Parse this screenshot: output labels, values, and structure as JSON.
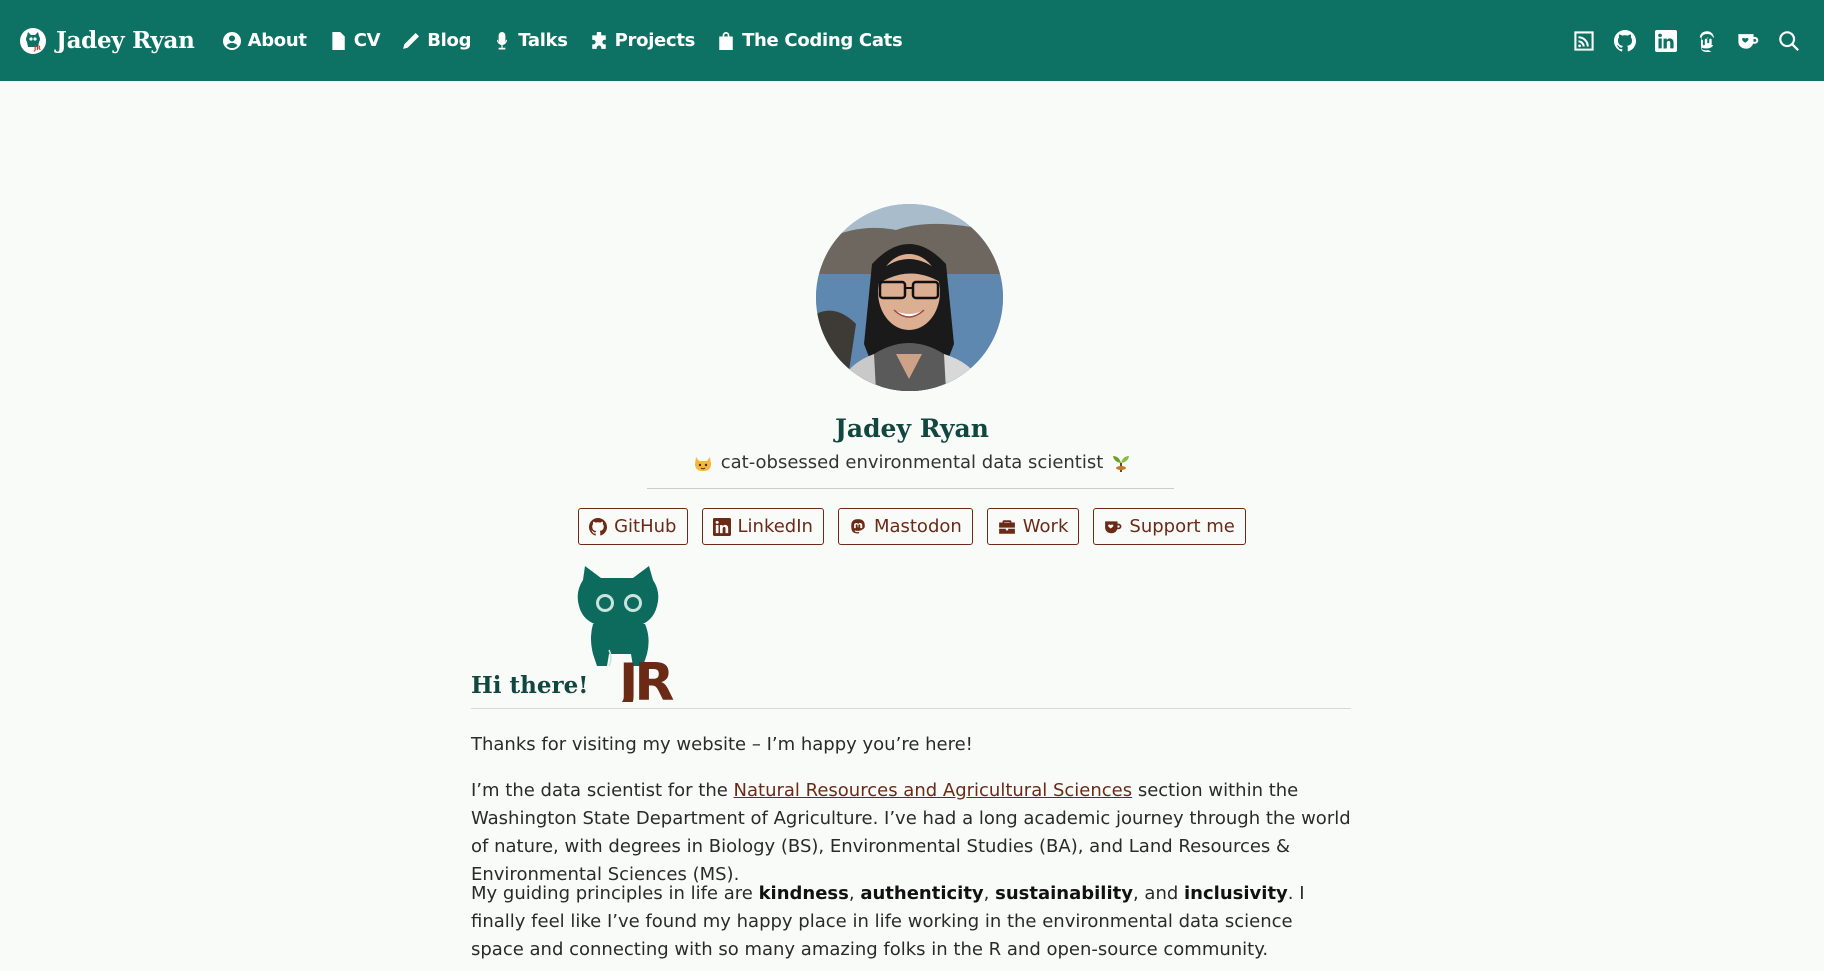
{
  "nav": {
    "brand": "Jadey Ryan",
    "links": [
      {
        "label": "About",
        "icon": "person-circle-icon"
      },
      {
        "label": "CV",
        "icon": "file-text-icon"
      },
      {
        "label": "Blog",
        "icon": "pencil-icon"
      },
      {
        "label": "Talks",
        "icon": "microphone-icon"
      },
      {
        "label": "Projects",
        "icon": "puzzle-icon"
      },
      {
        "label": "The Coding Cats",
        "icon": "bag-icon"
      }
    ],
    "right_icons": [
      "rss-icon",
      "github-icon",
      "linkedin-icon",
      "mastodon-icon",
      "kofi-cup-icon",
      "search-icon"
    ]
  },
  "profile": {
    "name": "Jadey Ryan",
    "tagline": "cat-obsessed environmental data scientist"
  },
  "buttons": [
    {
      "label": "GitHub",
      "icon": "github-icon"
    },
    {
      "label": "LinkedIn",
      "icon": "linkedin-icon"
    },
    {
      "label": "Mastodon",
      "icon": "mastodon-icon"
    },
    {
      "label": "Work",
      "icon": "briefcase-icon"
    },
    {
      "label": "Support me",
      "icon": "kofi-cup-icon"
    }
  ],
  "content": {
    "heading": "Hi there!",
    "p1": "Thanks for visiting my website – I’m happy you’re here!",
    "p2_before": "I’m the data scientist for the ",
    "p2_link": "Natural Resources and Agricultural Sciences",
    "p2_after": " section within the Washington State Department of Agriculture. I’ve had a long academic journey through the world of nature, with degrees in Biology (BS), Environmental Studies (BA), and Land Resources & Environmental Sciences (MS).",
    "p3_a": "My guiding principles in life are ",
    "p3_kindness": "kindness",
    "p3_sep1": ", ",
    "p3_authenticity": "authenticity",
    "p3_sep2": ", ",
    "p3_sustainability": "sustainability",
    "p3_sep3": ", and ",
    "p3_inclusivity": "inclusivity",
    "p3_b": ". I finally feel like I’ve found my happy place in life working in the environmental data science space and connecting with so many amazing folks in the R and open-source community."
  },
  "colors": {
    "navbar": "#0d7264",
    "accent_brown": "#6b2a16",
    "heading_teal": "#12473f"
  }
}
